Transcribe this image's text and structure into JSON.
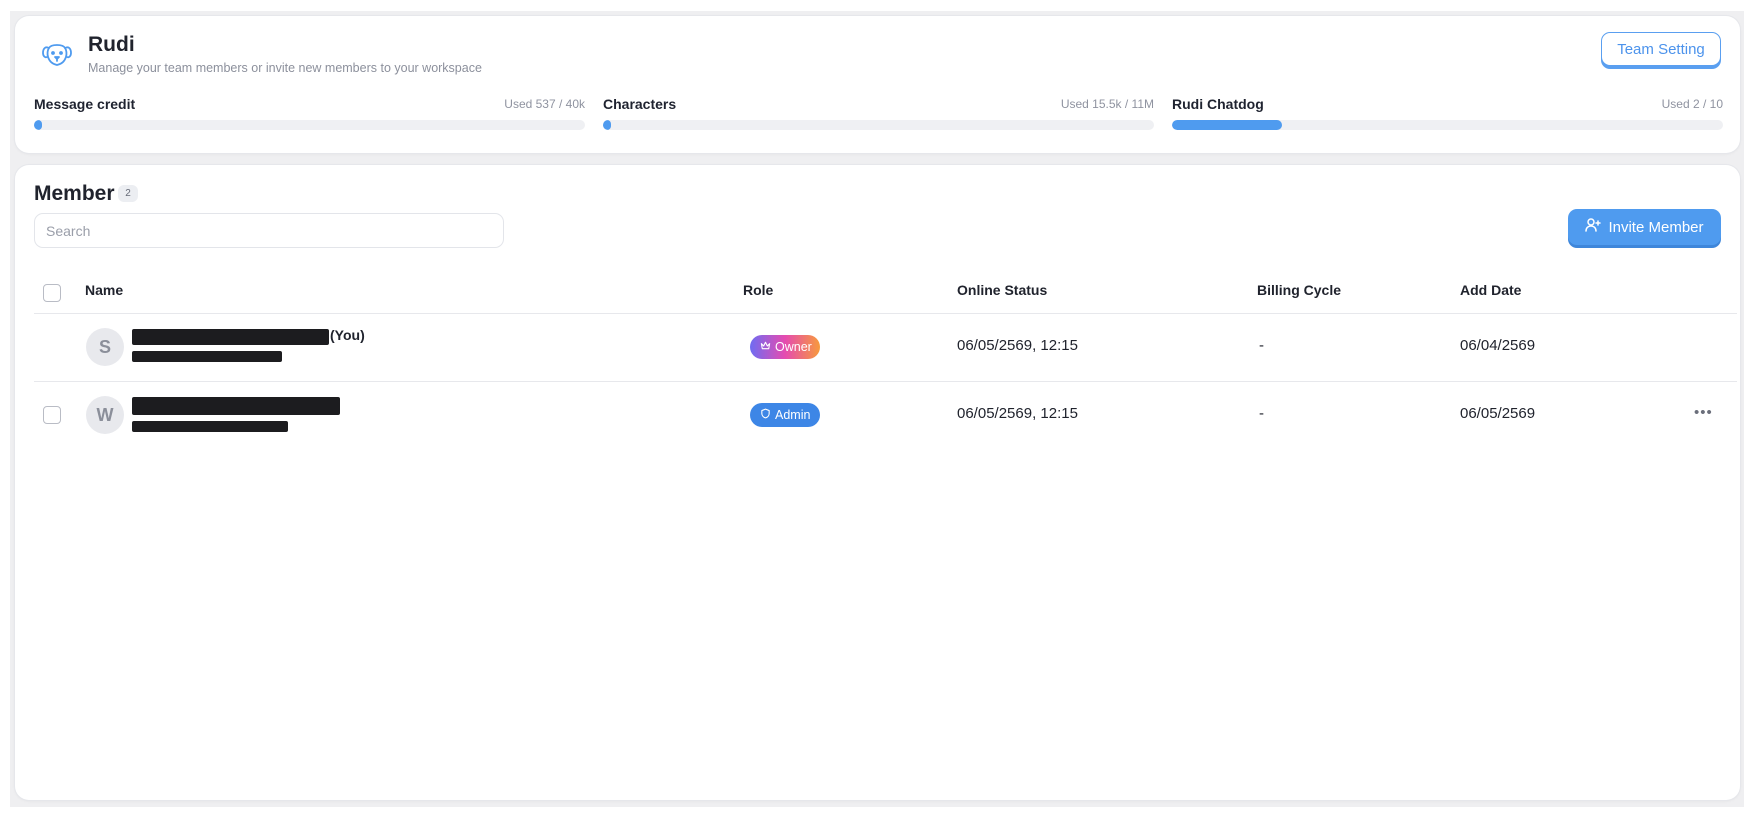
{
  "workspace": {
    "logo_icon": "dog-face-icon",
    "name": "Rudi",
    "subtitle": "Manage your team members or invite new members to your workspace",
    "team_setting_label": "Team Setting",
    "usage": [
      {
        "label": "Message credit",
        "used_text": "Used 537 / 40k",
        "fraction": 0.013
      },
      {
        "label": "Characters",
        "used_text": "Used 15.5k / 11M",
        "fraction": 0.0014
      },
      {
        "label": "Rudi Chatdog",
        "used_text": "Used 2 / 10",
        "fraction": 0.2
      }
    ]
  },
  "members": {
    "title": "Member",
    "count": "2",
    "search_placeholder": "Search",
    "invite_label": "Invite Member",
    "invite_icon": "user-plus-icon",
    "columns": {
      "name": "Name",
      "role": "Role",
      "online_status": "Online Status",
      "billing_cycle": "Billing Cycle",
      "add_date": "Add Date"
    },
    "rows": [
      {
        "initial": "S",
        "you_tag": "(You)",
        "role": "Owner",
        "role_icon": "crown-icon",
        "online_status": "06/05/2569, 12:15",
        "billing_cycle": "-",
        "add_date": "06/04/2569"
      },
      {
        "initial": "W",
        "role": "Admin",
        "role_icon": "shield-icon",
        "online_status": "06/05/2569, 12:15",
        "billing_cycle": "-",
        "add_date": "06/05/2569",
        "actions_icon": "more-horizontal-icon"
      }
    ]
  },
  "colors": {
    "accent": "#4f9bef",
    "admin_badge": "#3d86e6",
    "owner_gradient": [
      "#6f6cf2",
      "#e54bb0",
      "#f79a3c"
    ]
  }
}
